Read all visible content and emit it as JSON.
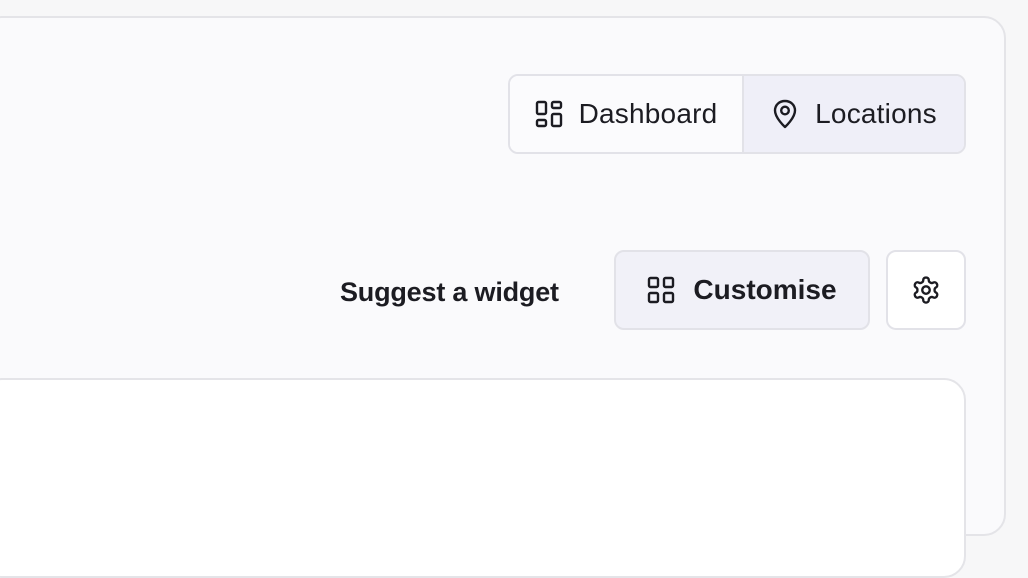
{
  "view_toggle": {
    "dashboard": {
      "label": "Dashboard",
      "icon": "dashboard-grid-icon",
      "selected": false
    },
    "locations": {
      "label": "Locations",
      "icon": "map-pin-icon",
      "selected": true
    }
  },
  "toolbar": {
    "suggest_label": "Suggest a widget",
    "customise_label": "Customise",
    "customise_icon": "dashboard-grid-icon",
    "settings_icon": "gear-icon"
  },
  "colors": {
    "text": "#1c1c22",
    "border": "#e2e2e8",
    "selected_bg": "#efeff8",
    "page_bg": "#fafafc"
  }
}
